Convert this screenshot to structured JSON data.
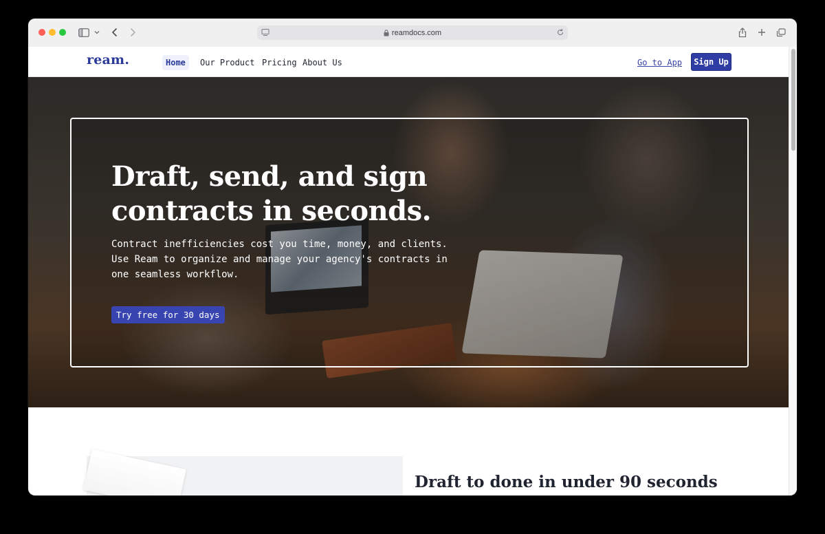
{
  "browser": {
    "url": "reamdocs.com"
  },
  "nav": {
    "logo": "ream.",
    "links": [
      {
        "label": "Home",
        "active": true
      },
      {
        "label": "Our Product",
        "active": false
      },
      {
        "label": "Pricing",
        "active": false
      },
      {
        "label": "About Us",
        "active": false
      }
    ],
    "go_to_app": "Go to App",
    "sign_up": "Sign Up"
  },
  "hero": {
    "title": "Draft, send, and sign contracts in seconds.",
    "subtitle": "Contract inefficiencies cost you time, money, and clients. Use Ream to organize and manage your agency's contracts in one seamless workflow.",
    "cta": "Try free for 30 days"
  },
  "section": {
    "title": "Draft to done in under 90 seconds"
  },
  "colors": {
    "brand": "#2e3ca3",
    "cta": "#3845b0",
    "text_dark": "#1f2430"
  },
  "icons": [
    "sidebar-toggle-icon",
    "chevron-down-icon",
    "back-arrow-icon",
    "forward-arrow-icon",
    "site-settings-icon",
    "lock-icon",
    "reload-icon",
    "share-icon",
    "new-tab-icon",
    "tab-overview-icon"
  ]
}
